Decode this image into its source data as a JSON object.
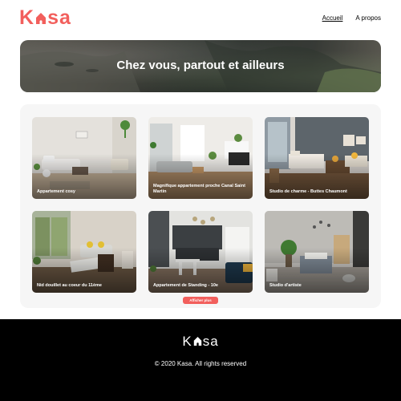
{
  "header": {
    "logo_left": "K",
    "logo_right": "sa",
    "logo_color": "#f25f5c",
    "nav": [
      {
        "label": "Accueil",
        "active": true
      },
      {
        "label": "A propos",
        "active": false
      }
    ]
  },
  "hero": {
    "title": "Chez vous, partout et ailleurs"
  },
  "gallery": {
    "cards": [
      {
        "title": "Appartement cosy"
      },
      {
        "title": "Magnifique appartement proche Canal Saint Martin"
      },
      {
        "title": "Studio de charme - Buttes Chaumont"
      },
      {
        "title": "Nid douillet au coeur du 11ème"
      },
      {
        "title": "Appartement de Standing - 10e"
      },
      {
        "title": "Studio d'artiste"
      }
    ],
    "more_label": "Afficher plus"
  },
  "footer": {
    "logo_left": "K",
    "logo_right": "sa",
    "copyright": "© 2020 Kasa. All rights reserved"
  }
}
